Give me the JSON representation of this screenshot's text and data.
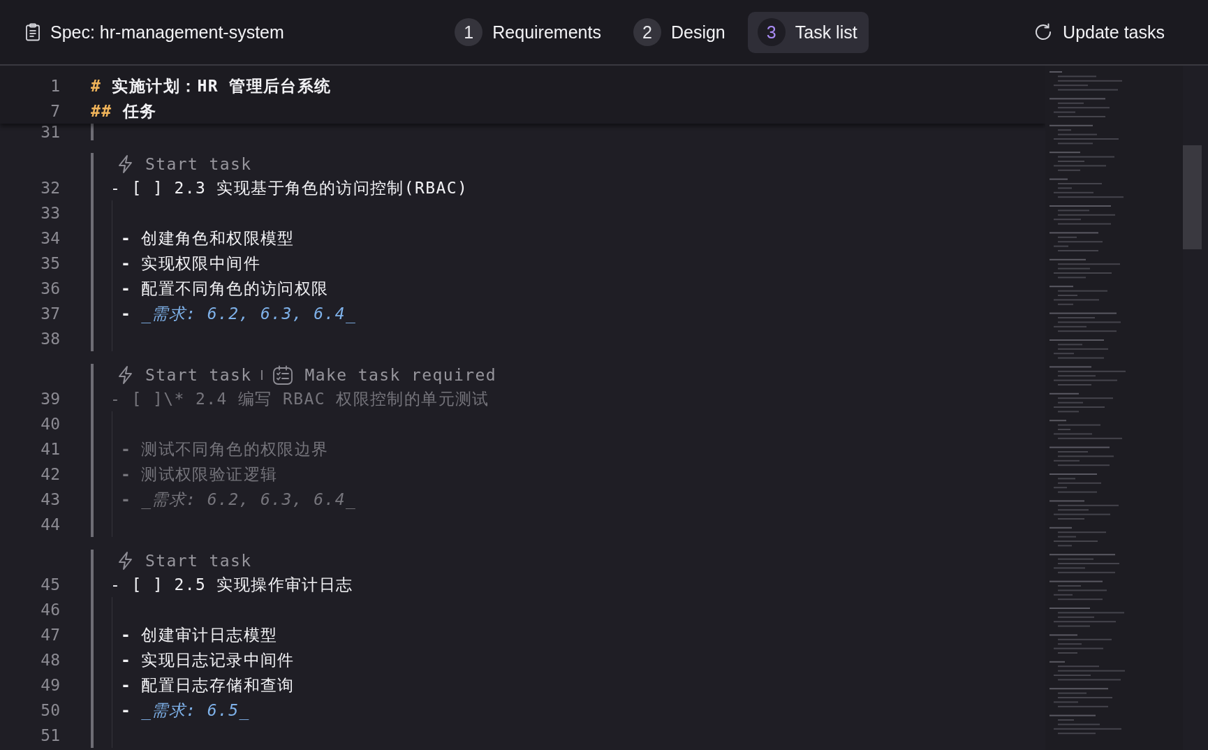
{
  "header": {
    "title": "Spec: hr-management-system",
    "steps": [
      {
        "number": "1",
        "label": "Requirements",
        "selected": false
      },
      {
        "number": "2",
        "label": "Design",
        "selected": false
      },
      {
        "number": "3",
        "label": "Task list",
        "selected": true
      }
    ],
    "action": "Update tasks"
  },
  "editor": {
    "sticky_lines": [
      {
        "number": "1",
        "marker": "#",
        "text": "实施计划：HR 管理后台系统"
      },
      {
        "number": "7",
        "marker": "##",
        "text": "任务"
      }
    ],
    "lines_before": [
      {
        "number": "31"
      }
    ],
    "tasks": [
      {
        "dimmed": false,
        "actions": [
          {
            "kind": "start",
            "label": "Start task"
          }
        ],
        "number": "32",
        "text": "- [ ] 2.3 实现基于角色的访问控制(RBAC)",
        "lines": [
          {
            "number": "33"
          },
          {
            "number": "34",
            "kind": "item",
            "bullet": "-",
            "text": "创建角色和权限模型"
          },
          {
            "number": "35",
            "kind": "item",
            "bullet": "-",
            "text": "实现权限中间件"
          },
          {
            "number": "36",
            "kind": "item",
            "bullet": "-",
            "text": "配置不同角色的访问权限"
          },
          {
            "number": "37",
            "kind": "requirement",
            "bullet": "-",
            "text": "_需求: 6.2, 6.3, 6.4_"
          },
          {
            "number": "38"
          }
        ]
      },
      {
        "dimmed": true,
        "actions": [
          {
            "kind": "start",
            "label": "Start task"
          },
          {
            "kind": "require",
            "label": "Make task required"
          }
        ],
        "number": "39",
        "text": "- [ ]\\* 2.4 编写 RBAC 权限控制的单元测试",
        "lines": [
          {
            "number": "40"
          },
          {
            "number": "41",
            "kind": "item",
            "bullet": "-",
            "text": "测试不同角色的权限边界"
          },
          {
            "number": "42",
            "kind": "item",
            "bullet": "-",
            "text": "测试权限验证逻辑"
          },
          {
            "number": "43",
            "kind": "requirement",
            "bullet": "-",
            "text": "_需求: 6.2, 6.3, 6.4_"
          },
          {
            "number": "44"
          }
        ]
      },
      {
        "dimmed": false,
        "actions": [
          {
            "kind": "start",
            "label": "Start task"
          }
        ],
        "number": "45",
        "text": "- [ ] 2.5 实现操作审计日志",
        "lines": [
          {
            "number": "46"
          },
          {
            "number": "47",
            "kind": "item",
            "bullet": "-",
            "text": "创建审计日志模型"
          },
          {
            "number": "48",
            "kind": "item",
            "bullet": "-",
            "text": "实现日志记录中间件"
          },
          {
            "number": "49",
            "kind": "item",
            "bullet": "-",
            "text": "配置日志存储和查询"
          },
          {
            "number": "50",
            "kind": "requirement",
            "bullet": "-",
            "text": "_需求: 6.5_"
          },
          {
            "number": "51"
          }
        ]
      }
    ]
  }
}
